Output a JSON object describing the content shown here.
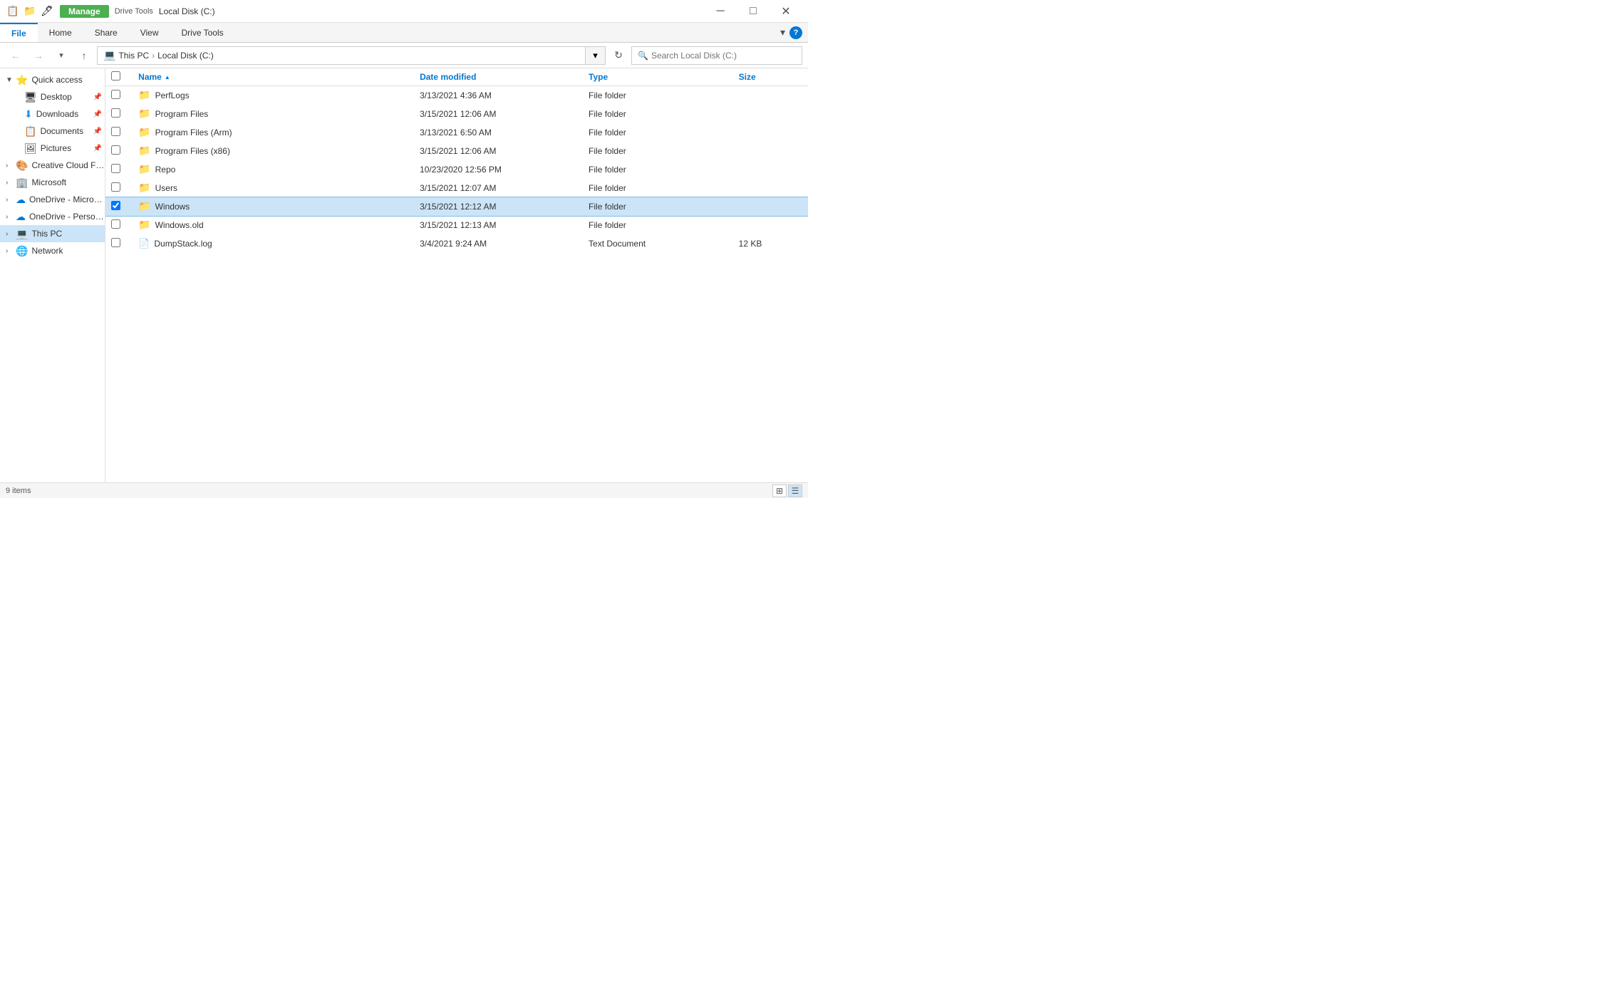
{
  "titleBar": {
    "icons": [
      "📋",
      "📁",
      "🖊"
    ],
    "manageLabel": "Manage",
    "driveToolsLabel": "Drive Tools",
    "title": "Local Disk (C:)",
    "minimizeLabel": "─",
    "maximizeLabel": "□",
    "closeLabel": "✕"
  },
  "ribbon": {
    "tabs": [
      {
        "id": "file",
        "label": "File",
        "active": true
      },
      {
        "id": "home",
        "label": "Home",
        "active": false
      },
      {
        "id": "share",
        "label": "Share",
        "active": false
      },
      {
        "id": "view",
        "label": "View",
        "active": false
      },
      {
        "id": "drive-tools",
        "label": "Drive Tools",
        "active": false
      }
    ]
  },
  "addressBar": {
    "backLabel": "←",
    "forwardLabel": "→",
    "dropdownLabel": "▾",
    "upLabel": "↑",
    "pathParts": [
      "This PC",
      "Local Disk (C:)"
    ],
    "searchPlaceholder": "Search Local Disk (C:)",
    "refreshLabel": "↻"
  },
  "sidebar": {
    "items": [
      {
        "id": "quick-access",
        "label": "Quick access",
        "expanded": true,
        "depth": 0,
        "icon": "⭐",
        "iconColor": "#0078d4",
        "hasArrow": true,
        "arrowDown": true
      },
      {
        "id": "desktop",
        "label": "Desktop",
        "depth": 1,
        "icon": "🖥",
        "pinned": true
      },
      {
        "id": "downloads",
        "label": "Downloads",
        "depth": 1,
        "icon": "⬇",
        "iconColor": "#2196F3",
        "pinned": true
      },
      {
        "id": "documents",
        "label": "Documents",
        "depth": 1,
        "icon": "📋",
        "pinned": true
      },
      {
        "id": "pictures",
        "label": "Pictures",
        "depth": 1,
        "icon": "🖼",
        "pinned": true
      },
      {
        "id": "creative-cloud",
        "label": "Creative Cloud Files",
        "depth": 0,
        "icon": "🎨",
        "hasArrow": true,
        "arrowDown": false
      },
      {
        "id": "microsoft",
        "label": "Microsoft",
        "depth": 0,
        "icon": "🏢",
        "hasArrow": true,
        "arrowDown": false
      },
      {
        "id": "onedrive-microsoft",
        "label": "OneDrive - Microsoft",
        "depth": 0,
        "icon": "☁",
        "iconColor": "#0078d4",
        "hasArrow": true,
        "arrowDown": false
      },
      {
        "id": "onedrive-personal",
        "label": "OneDrive - Personal",
        "depth": 0,
        "icon": "☁",
        "iconColor": "#0078d4",
        "hasArrow": true,
        "arrowDown": false
      },
      {
        "id": "this-pc",
        "label": "This PC",
        "depth": 0,
        "icon": "💻",
        "iconColor": "#0078d4",
        "hasArrow": true,
        "arrowDown": false,
        "active": true
      },
      {
        "id": "network",
        "label": "Network",
        "depth": 0,
        "icon": "🌐",
        "iconColor": "#0078d4",
        "hasArrow": true,
        "arrowDown": false
      }
    ]
  },
  "fileList": {
    "columns": [
      {
        "id": "check",
        "label": ""
      },
      {
        "id": "name",
        "label": "Name",
        "sortActive": true,
        "sortDir": "asc"
      },
      {
        "id": "date",
        "label": "Date modified"
      },
      {
        "id": "type",
        "label": "Type"
      },
      {
        "id": "size",
        "label": "Size"
      }
    ],
    "rows": [
      {
        "id": "perflogs",
        "name": "PerfLogs",
        "date": "3/13/2021 4:36 AM",
        "type": "File folder",
        "size": "",
        "icon": "folder",
        "selected": false
      },
      {
        "id": "program-files",
        "name": "Program Files",
        "date": "3/15/2021 12:06 AM",
        "type": "File folder",
        "size": "",
        "icon": "folder",
        "selected": false
      },
      {
        "id": "program-files-arm",
        "name": "Program Files (Arm)",
        "date": "3/13/2021 6:50 AM",
        "type": "File folder",
        "size": "",
        "icon": "folder",
        "selected": false
      },
      {
        "id": "program-files-x86",
        "name": "Program Files (x86)",
        "date": "3/15/2021 12:06 AM",
        "type": "File folder",
        "size": "",
        "icon": "folder",
        "selected": false
      },
      {
        "id": "repo",
        "name": "Repo",
        "date": "10/23/2020 12:56 PM",
        "type": "File folder",
        "size": "",
        "icon": "folder",
        "selected": false
      },
      {
        "id": "users",
        "name": "Users",
        "date": "3/15/2021 12:07 AM",
        "type": "File folder",
        "size": "",
        "icon": "folder",
        "selected": false
      },
      {
        "id": "windows",
        "name": "Windows",
        "date": "3/15/2021 12:12 AM",
        "type": "File folder",
        "size": "",
        "icon": "folder",
        "selected": true
      },
      {
        "id": "windows-old",
        "name": "Windows.old",
        "date": "3/15/2021 12:13 AM",
        "type": "File folder",
        "size": "",
        "icon": "folder",
        "selected": false
      },
      {
        "id": "dumpstack",
        "name": "DumpStack.log",
        "date": "3/4/2021 9:24 AM",
        "type": "Text Document",
        "size": "12 KB",
        "icon": "file",
        "selected": false
      }
    ]
  },
  "statusBar": {
    "itemCount": "9 items",
    "viewDetails": "⊞",
    "viewList": "☰"
  }
}
